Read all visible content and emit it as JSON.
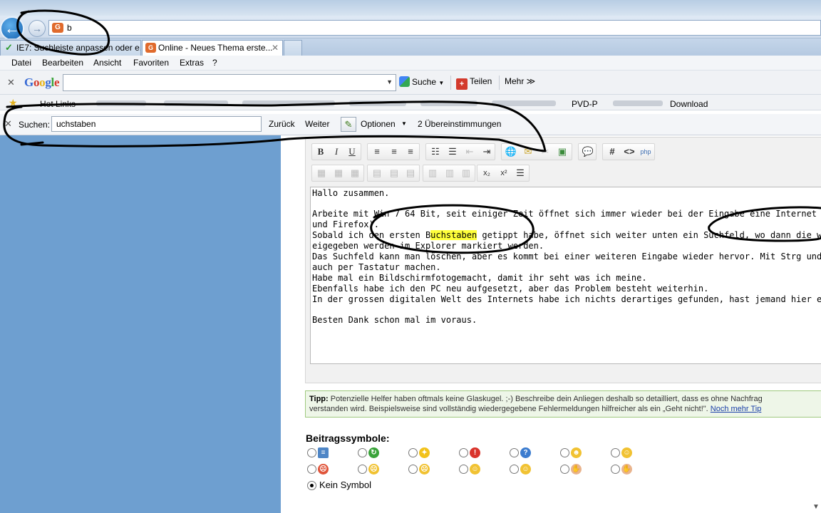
{
  "browser": {
    "address_text": "b",
    "tabs": [
      {
        "label": "IE7: Suchleiste anpassen oder e..."
      },
      {
        "label": "Online - Neues Thema erste...",
        "close": "✕"
      }
    ],
    "menu": [
      "Datei",
      "Bearbeiten",
      "Ansicht",
      "Favoriten",
      "Extras",
      "?"
    ]
  },
  "google_toolbar": {
    "logo": "Google",
    "search_value": "",
    "suche_label": "Suche",
    "teilen_label": "Teilen",
    "mehr_label": "Mehr ≫"
  },
  "links_bar": {
    "hot_links": "Hot Links",
    "pvd": "PVD-P",
    "download": "Download"
  },
  "find_bar": {
    "label": "Suchen:",
    "value": "uchstaben",
    "prev": "Zurück",
    "next": "Weiter",
    "options": "Optionen",
    "count": "2 Übereinstimmungen"
  },
  "editor": {
    "lines": [
      {
        "pre": "Hallo zusammen.",
        "hl": "",
        "post": ""
      },
      {
        "pre": "Arbeite mit Win 7 64 Bit, seit einiger Zeit öffnet sich immer wieder bei der Eingabe eine Internet Adresse ein Suchfeld",
        "hl": "",
        "post": ""
      },
      {
        "pre": "und Firefox).",
        "hl": "",
        "post": ""
      },
      {
        "pre": "Sobald ich den ersten B",
        "hl": "uchstaben",
        "post": " getippt habe, öffnet sich weiter unten ein Suchfeld, wo dann die weiteren B"
      },
      {
        "pre": "eigegeben werden im Explorer markiert werden.",
        "hl": "",
        "post": ""
      },
      {
        "pre": "Das Suchfeld kann man löschen, aber es kommt bei einer weiteren Eingabe wieder hervor. Mit Strg und F kann man d",
        "hl": "",
        "post": ""
      },
      {
        "pre": "auch per Tastatur machen.",
        "hl": "",
        "post": ""
      },
      {
        "pre": "Habe mal ein Bildschirmfotogemacht, damit ihr seht was ich meine.",
        "hl": "",
        "post": ""
      },
      {
        "pre": "Ebenfalls habe ich den PC neu aufgesetzt, aber das Problem besteht weiterhin.",
        "hl": "",
        "post": ""
      },
      {
        "pre": "In der grossen digitalen Welt des Internets habe ich nichts derartiges gefunden, hast jemand hier einen Rat?",
        "hl": "",
        "post": ""
      },
      {
        "pre": "Besten Dank schon mal im voraus.",
        "hl": "",
        "post": ""
      }
    ],
    "second_highlight": "uchstabe"
  },
  "tip": {
    "label": "Tipp:",
    "text1": " Potenzielle Helfer haben oftmals keine Glaskugel. ;-) Beschreibe dein Anliegen deshalb so detailliert, dass es ohne Nachfrag",
    "text2": "verstanden wird. Beispielsweise sind vollständig wiedergegebene Fehlermeldungen hilfreicher als ein „Geht nicht!\". ",
    "link": "Noch mehr Tip"
  },
  "symbols": {
    "title": "Beitragssymbole:",
    "none_label": "Kein Symbol",
    "icons": [
      {
        "name": "document",
        "color": "#4f86c6",
        "glyph": "≡"
      },
      {
        "name": "arrow",
        "color": "#3aa33a",
        "glyph": "↻"
      },
      {
        "name": "lightbulb",
        "color": "#f2c21b",
        "glyph": "✦"
      },
      {
        "name": "exclamation",
        "color": "#d9342b",
        "glyph": "!"
      },
      {
        "name": "question",
        "color": "#3c7ccf",
        "glyph": "?"
      },
      {
        "name": "cool",
        "color": "#f1c232",
        "glyph": "☻"
      },
      {
        "name": "smile",
        "color": "#f1c232",
        "glyph": "☺"
      },
      {
        "name": "angry",
        "color": "#e0553b",
        "glyph": "☹"
      },
      {
        "name": "confused",
        "color": "#f1c232",
        "glyph": "☹"
      },
      {
        "name": "sad",
        "color": "#f1c232",
        "glyph": "☹"
      },
      {
        "name": "happy",
        "color": "#f1c232",
        "glyph": "☺"
      },
      {
        "name": "grin",
        "color": "#f1c232",
        "glyph": "☺"
      },
      {
        "name": "thumbs-down",
        "color": "#e9b48e",
        "glyph": "✋"
      },
      {
        "name": "thumbs-up",
        "color": "#e9b48e",
        "glyph": "✋"
      }
    ]
  }
}
